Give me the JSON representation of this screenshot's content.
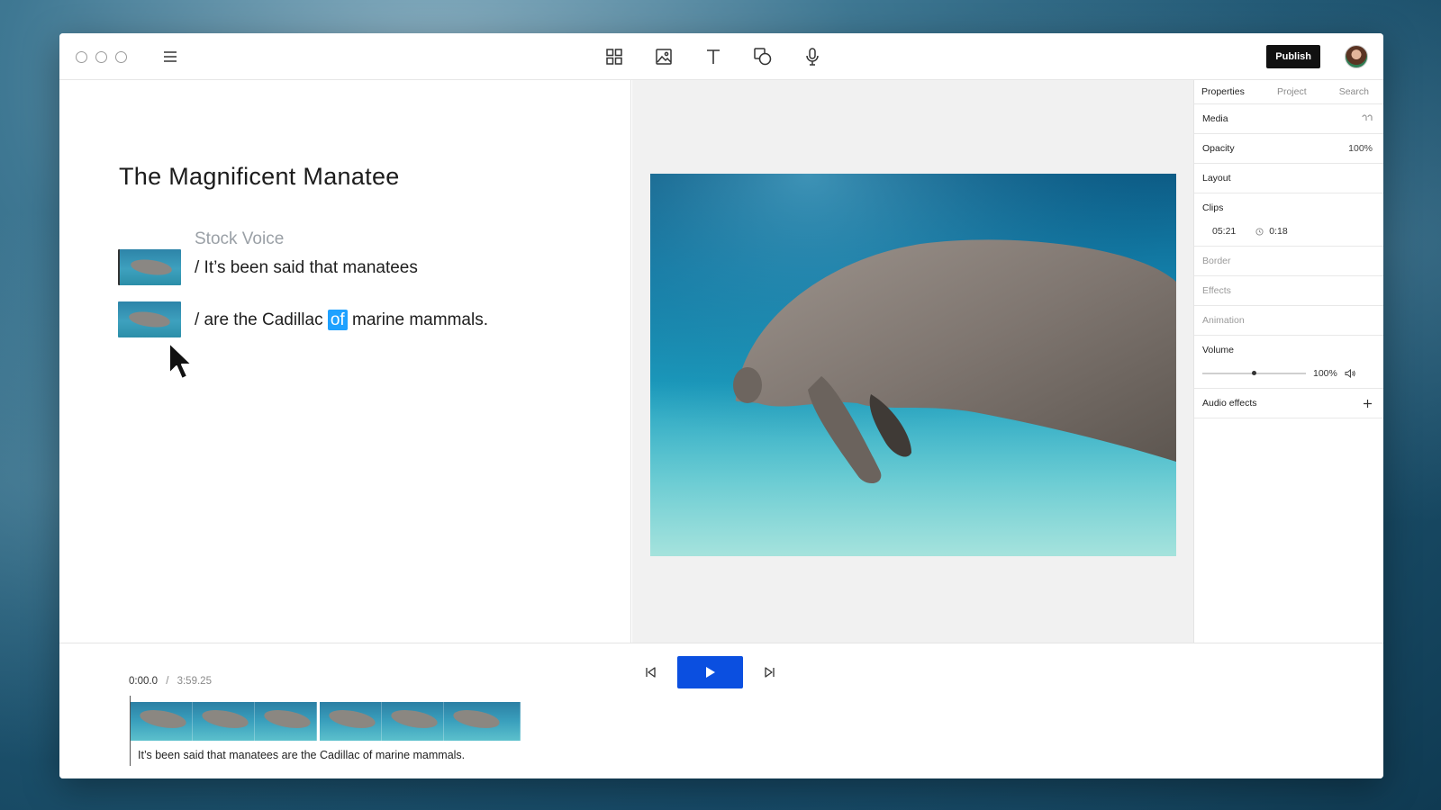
{
  "toolbar": {
    "tools": [
      "grid-icon",
      "image-icon",
      "text-icon",
      "shapes-icon",
      "microphone-icon"
    ],
    "publish_label": "Publish"
  },
  "script": {
    "title": "The Magnificent Manatee",
    "voice_label": "Stock Voice",
    "line1": "/ It’s been said that manatees",
    "line2_before": "/ are the Cadillac ",
    "line2_highlight": "of",
    "line2_after": " marine mammals."
  },
  "properties": {
    "tabs": [
      "Properties",
      "Project",
      "Search"
    ],
    "media_label": "Media",
    "opacity_label": "Opacity",
    "opacity_value": "100%",
    "layout_label": "Layout",
    "clips_label": "Clips",
    "clips_start": "05:21",
    "clips_duration": "0:18",
    "border_label": "Border",
    "effects_label": "Effects",
    "animation_label": "Animation",
    "volume_label": "Volume",
    "volume_value": "100%",
    "volume_level": 0.5,
    "audio_effects_label": "Audio effects"
  },
  "timeline": {
    "current_time": "0:00.0",
    "separator": "/",
    "total_time": "3:59.25",
    "caption": "It’s been said that manatees are the Cadillac of marine mammals."
  }
}
